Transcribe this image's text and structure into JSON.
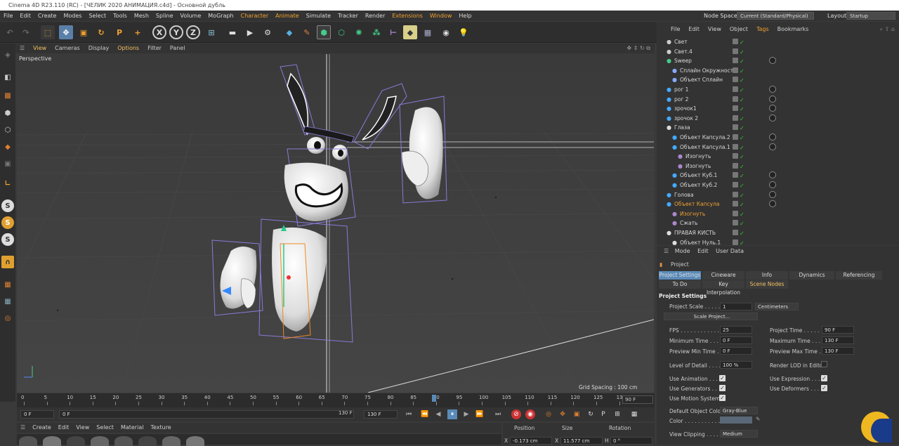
{
  "window": {
    "title": "Cinema 4D R23.110 (RC) - [ЧЕЛИК 2020 АНИМАЦИЯ.c4d] - Основной дубль"
  },
  "menu": [
    "File",
    "Edit",
    "Create",
    "Modes",
    "Select",
    "Tools",
    "Mesh",
    "Spline",
    "Volume",
    "MoGraph",
    "Character",
    "Animate",
    "Simulate",
    "Tracker",
    "Render",
    "Extensions",
    "Window",
    "Help"
  ],
  "node_space": {
    "label": "Node Space:",
    "value": "Current (Standard/Physical)"
  },
  "layout": {
    "label": "Layout:",
    "value": "Startup"
  },
  "toolbar_axis": [
    "X",
    "Y",
    "Z"
  ],
  "viewport": {
    "menu": [
      "View",
      "Cameras",
      "Display",
      "Options",
      "Filter",
      "Panel"
    ],
    "label": "Perspective",
    "grid_spacing": "Grid Spacing : 100 cm"
  },
  "timeline": {
    "ticks": [
      "0",
      "5",
      "10",
      "15",
      "20",
      "25",
      "30",
      "35",
      "40",
      "45",
      "50",
      "55",
      "60",
      "65",
      "70",
      "75",
      "80",
      "85",
      "90",
      "95",
      "100",
      "105",
      "110",
      "115",
      "120",
      "125",
      "130"
    ],
    "current_frame": "90 F",
    "start": "0 F",
    "min": "0 F",
    "max": "130 F",
    "end": "130 F"
  },
  "material_menu": [
    "Create",
    "Edit",
    "View",
    "Select",
    "Material",
    "Texture"
  ],
  "coords": {
    "headers": [
      "Position",
      "Size",
      "Rotation"
    ],
    "x_pos": "-0.173 cm",
    "x_size": "11.577 cm",
    "h_rot": "0 °",
    "x": "X",
    "x2": "X",
    "h": "H"
  },
  "object_manager": {
    "menu": [
      "File",
      "Edit",
      "View",
      "Object",
      "Tags",
      "Bookmarks"
    ],
    "objects": [
      {
        "name": "Свет",
        "indent": 0
      },
      {
        "name": "Свет.4",
        "indent": 0
      },
      {
        "name": "Sweep",
        "indent": 0
      },
      {
        "name": "Сплайн Окружность",
        "indent": 1
      },
      {
        "name": "Объект Сплайн",
        "indent": 1
      },
      {
        "name": "рог 1",
        "indent": 0
      },
      {
        "name": "рог 2",
        "indent": 0
      },
      {
        "name": "зрочок1",
        "indent": 0
      },
      {
        "name": "зрочок 2",
        "indent": 0
      },
      {
        "name": "Глаза",
        "indent": 0
      },
      {
        "name": "Объект Капсула.2",
        "indent": 1
      },
      {
        "name": "Объект Капсула.1",
        "indent": 1
      },
      {
        "name": "Изогнуть",
        "indent": 2
      },
      {
        "name": "Изогнуть",
        "indent": 2
      },
      {
        "name": "Объект Куб.1",
        "indent": 1
      },
      {
        "name": "Объект Куб.2",
        "indent": 1
      },
      {
        "name": "Голова",
        "indent": 0
      },
      {
        "name": "Объект Капсула",
        "indent": 0,
        "selected": true
      },
      {
        "name": "Изогнуть",
        "indent": 1,
        "selected": true
      },
      {
        "name": "Сжать",
        "indent": 1
      },
      {
        "name": "ПРАВАЯ КИСТЬ",
        "indent": 0
      },
      {
        "name": "Объект Нуль.1",
        "indent": 1
      }
    ]
  },
  "attributes": {
    "menu": [
      "Mode",
      "Edit",
      "User Data"
    ],
    "object": "Project",
    "tabs": [
      "Project Settings",
      "Cineware",
      "Info",
      "Dynamics",
      "Referencing"
    ],
    "tabs2": [
      "To Do",
      "Key Interpolation",
      "Scene Nodes"
    ],
    "section": "Project Settings",
    "project_scale": {
      "label": "Project Scale . . . . .",
      "value": "1",
      "unit": "Centimeters"
    },
    "scale_button": "Scale Project...",
    "fps": {
      "label": "FPS . . . . . . . . . . . .",
      "value": "25"
    },
    "project_time": {
      "label": "Project Time . . . . .",
      "value": "90 F"
    },
    "min_time": {
      "label": "Minimum Time . . . . .",
      "value": "0 F"
    },
    "max_time": {
      "label": "Maximum Time . . . .",
      "value": "130 F"
    },
    "prev_min": {
      "label": "Preview Min Time . .",
      "value": "0 F"
    },
    "prev_max": {
      "label": "Preview Max Time . .",
      "value": "130 F"
    },
    "lod": {
      "label": "Level of Detail . . . .",
      "value": "100 %"
    },
    "render_lod": "Render LOD in Editor",
    "use_animation": "Use Animation . . . . .",
    "use_expression": "Use Expression . . . .",
    "use_generators": "Use Generators . . . .",
    "use_deformers": "Use Deformers . . . . .",
    "use_motion": "Use Motion System",
    "default_color": {
      "label": "Default Object Color",
      "value": "Gray-Blue"
    },
    "color_label": "Color . . . . . . . . . . .",
    "view_clipping": {
      "label": "View Clipping . . . . .",
      "value": "Medium"
    }
  }
}
